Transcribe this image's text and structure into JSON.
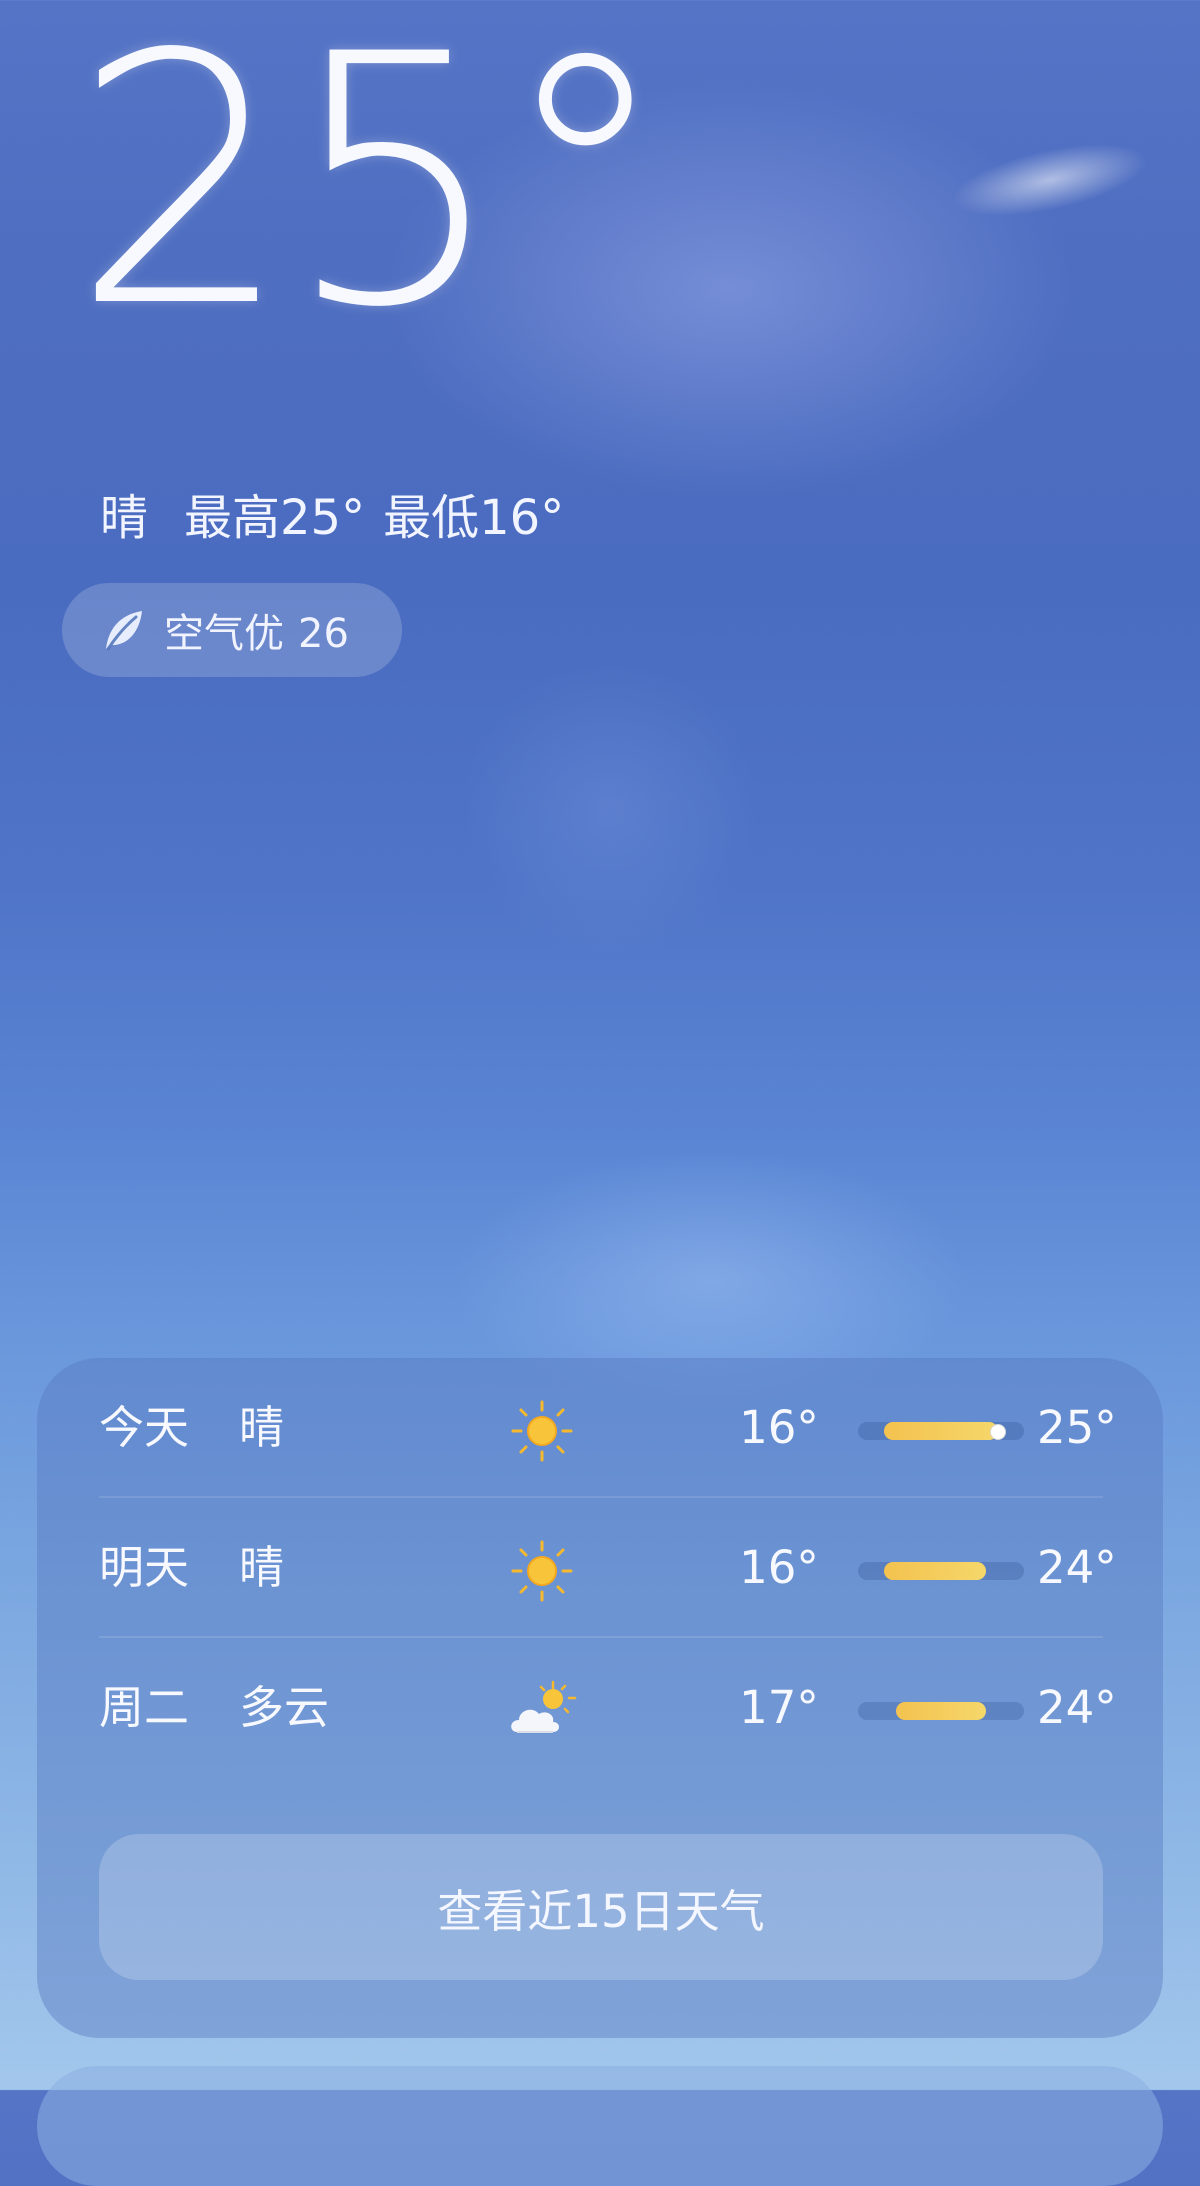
{
  "current": {
    "temperature": "25°",
    "condition": "晴",
    "high": "最高25°",
    "low": "最低16°"
  },
  "air_quality": {
    "label": "空气优",
    "value": "26"
  },
  "forecast": [
    {
      "day": "今天",
      "condition": "晴",
      "icon": "sun-icon",
      "low": "16°",
      "high": "25°",
      "range_low": 16,
      "range_high": 25,
      "current": 25
    },
    {
      "day": "明天",
      "condition": "晴",
      "icon": "sun-icon",
      "low": "16°",
      "high": "24°",
      "range_low": 16,
      "range_high": 24
    },
    {
      "day": "周二",
      "condition": "多云",
      "icon": "partly-cloudy-icon",
      "low": "17°",
      "high": "24°",
      "range_low": 17,
      "range_high": 24
    }
  ],
  "scale": {
    "min": 14,
    "max": 27
  },
  "more_button": "查看近15日天气",
  "colors": {
    "bar": "#f4c24f",
    "sun": "#f6b92e"
  }
}
